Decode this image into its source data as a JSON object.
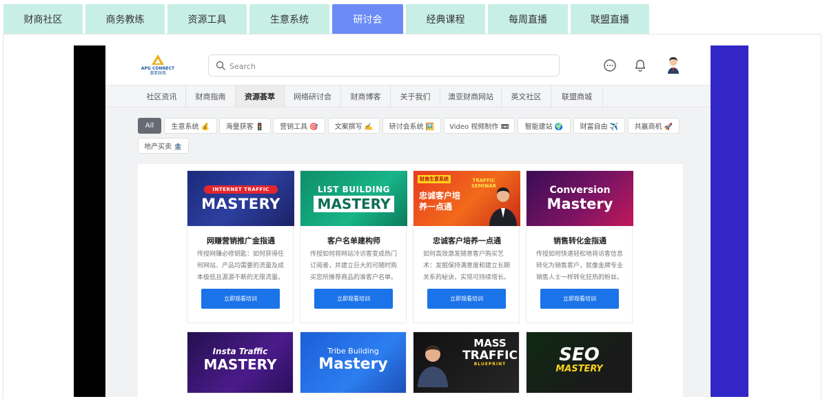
{
  "outer_tabs": [
    {
      "label": "财商社区"
    },
    {
      "label": "商务教练"
    },
    {
      "label": "资源工具"
    },
    {
      "label": "生意系统"
    },
    {
      "label": "研讨会",
      "active": true
    },
    {
      "label": "经典课程"
    },
    {
      "label": "每周直播"
    },
    {
      "label": "联盟直播"
    }
  ],
  "site": {
    "logo": {
      "text": "APG CONNECT",
      "sub": "澳亚财商"
    },
    "search": {
      "placeholder": "Search"
    },
    "nav": [
      {
        "label": "社区资讯"
      },
      {
        "label": "财商指南"
      },
      {
        "label": "资源荟萃",
        "active": true
      },
      {
        "label": "网络研讨会"
      },
      {
        "label": "财商博客"
      },
      {
        "label": "关于我们"
      },
      {
        "label": "澳亚财商网站"
      },
      {
        "label": "英文社区"
      },
      {
        "label": "联盟商城"
      }
    ],
    "filters": [
      {
        "label": "All",
        "active": true
      },
      {
        "label": "生意系统 💰"
      },
      {
        "label": "海量获客 🚦"
      },
      {
        "label": "营销工具 🎯"
      },
      {
        "label": "文案撰写 ✍️"
      },
      {
        "label": "研讨会系统 🖼️"
      },
      {
        "label": "Video 视频制作 📼"
      },
      {
        "label": "智能建站 🌍"
      },
      {
        "label": "财富自由 ✈️"
      },
      {
        "label": "共赢商机 🚀"
      },
      {
        "label": "地产买卖 🏦"
      }
    ]
  },
  "courses": [
    {
      "banner_top": "INTERNET TRAFFIC",
      "banner_main": "MASTERY",
      "title": "网赚营销推广金指通",
      "desc": "传授网赚必修钥匙：如何获得任何网站、产品均需要的流量及成本极低且源源不断的无限流量。",
      "button": "立即观看培训"
    },
    {
      "banner_top": "LIST BUILDING",
      "banner_main": "MASTERY",
      "title": "客户名单建构师",
      "desc": "传授如何将网站冷访客变成热门订阅者，并建立巨大的可随时购买您所推荐商品的准客户名单。",
      "button": "立即观看培训"
    },
    {
      "banner_top": "财商生意系统",
      "banner_main": "忠诚客户培养一点通",
      "banner_side": "TRAFFIC SEMINAR",
      "title": "忠诚客户培养一点通",
      "desc": "如何高效激发随意客户购买艺术：发掘保持满意度和建立长期关系的秘诀，实现可持续增长。",
      "button": "立即观看培训"
    },
    {
      "banner_top": "Conversion",
      "banner_main": "Mastery",
      "title": "销售转化金指通",
      "desc": "传授如何快速轻松地将访客信息转化为销售客户，就像金牌专业销售人士一样转化狂热的粉丝。",
      "button": "立即观看培训"
    }
  ],
  "courses_row2": [
    {
      "banner_top": "Insta Traffic",
      "banner_main": "MASTERY"
    },
    {
      "banner_top": "Tribe Building",
      "banner_main": "Mastery"
    },
    {
      "banner_top": "MASS",
      "banner_main": "TRAFFIC",
      "banner_sub": "BLUEPRINT"
    },
    {
      "banner_top": "SEO",
      "banner_main": "MASTERY"
    }
  ],
  "colors": {
    "active_tab": "#6b8cf5",
    "tab_bg": "#c8efe6",
    "button_blue": "#1a73e8",
    "video_right": "#3227c6"
  }
}
